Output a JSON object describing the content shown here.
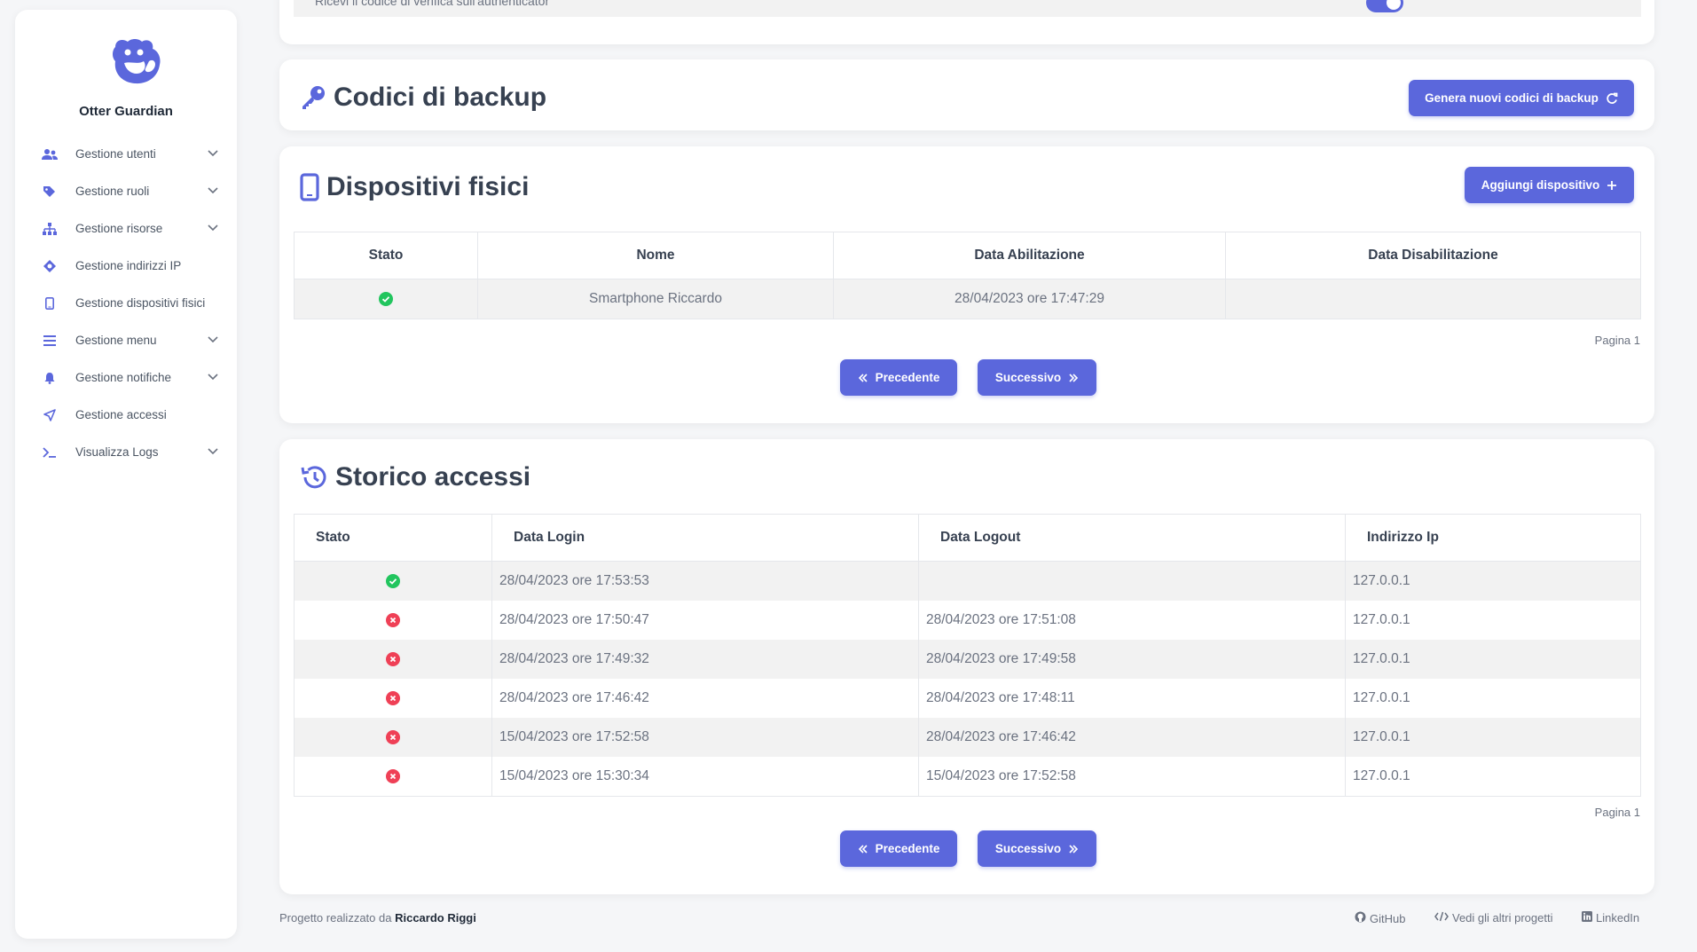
{
  "app": {
    "name": "Otter Guardian"
  },
  "sidebar": {
    "items": [
      {
        "label": "Gestione utenti",
        "icon": "users-icon",
        "has_submenu": true
      },
      {
        "label": "Gestione ruoli",
        "icon": "tags-icon",
        "has_submenu": true
      },
      {
        "label": "Gestione risorse",
        "icon": "sitemap-icon",
        "has_submenu": true
      },
      {
        "label": "Gestione indirizzi IP",
        "icon": "network-icon",
        "has_submenu": false
      },
      {
        "label": "Gestione dispositivi fisici",
        "icon": "mobile-icon",
        "has_submenu": false
      },
      {
        "label": "Gestione menu",
        "icon": "bars-icon",
        "has_submenu": true
      },
      {
        "label": "Gestione notifiche",
        "icon": "bell-icon",
        "has_submenu": true
      },
      {
        "label": "Gestione accessi",
        "icon": "location-arrow-icon",
        "has_submenu": false
      },
      {
        "label": "Visualizza Logs",
        "icon": "terminal-icon",
        "has_submenu": true
      }
    ]
  },
  "top_card": {
    "partial_text": "Ricevi il codice di verifica sull'authenticator",
    "toggle_on": true
  },
  "backup": {
    "title": "Codici di backup",
    "button": "Genera nuovi codici di backup"
  },
  "devices": {
    "title": "Dispositivi fisici",
    "add_button": "Aggiungi dispositivo",
    "columns": [
      "Stato",
      "Nome",
      "Data Abilitazione",
      "Data Disabilitazione"
    ],
    "rows": [
      {
        "status": "active",
        "name": "Smartphone Riccardo",
        "enabled": "28/04/2023 ore 17:47:29",
        "disabled": ""
      }
    ],
    "page_label": "Pagina 1",
    "prev": "Precedente",
    "next": "Successivo"
  },
  "history": {
    "title": "Storico accessi",
    "columns": [
      "Stato",
      "Data Login",
      "Data Logout",
      "Indirizzo Ip"
    ],
    "rows": [
      {
        "status": "active",
        "login": "28/04/2023 ore 17:53:53",
        "logout": "",
        "ip": "127.0.0.1"
      },
      {
        "status": "closed",
        "login": "28/04/2023 ore 17:50:47",
        "logout": "28/04/2023 ore 17:51:08",
        "ip": "127.0.0.1"
      },
      {
        "status": "closed",
        "login": "28/04/2023 ore 17:49:32",
        "logout": "28/04/2023 ore 17:49:58",
        "ip": "127.0.0.1"
      },
      {
        "status": "closed",
        "login": "28/04/2023 ore 17:46:42",
        "logout": "28/04/2023 ore 17:48:11",
        "ip": "127.0.0.1"
      },
      {
        "status": "closed",
        "login": "15/04/2023 ore 17:52:58",
        "logout": "28/04/2023 ore 17:46:42",
        "ip": "127.0.0.1"
      },
      {
        "status": "closed",
        "login": "15/04/2023 ore 15:30:34",
        "logout": "15/04/2023 ore 17:52:58",
        "ip": "127.0.0.1"
      }
    ],
    "page_label": "Pagina 1",
    "prev": "Precedente",
    "next": "Successivo"
  },
  "footer": {
    "prefix": "Progetto realizzato da",
    "author": "Riccardo Riggi",
    "links": [
      "GitHub",
      "Vedi gli altri progetti",
      "LinkedIn"
    ]
  },
  "colors": {
    "accent": "#5b67dc",
    "success": "#22c55e",
    "error": "#ef4056"
  }
}
